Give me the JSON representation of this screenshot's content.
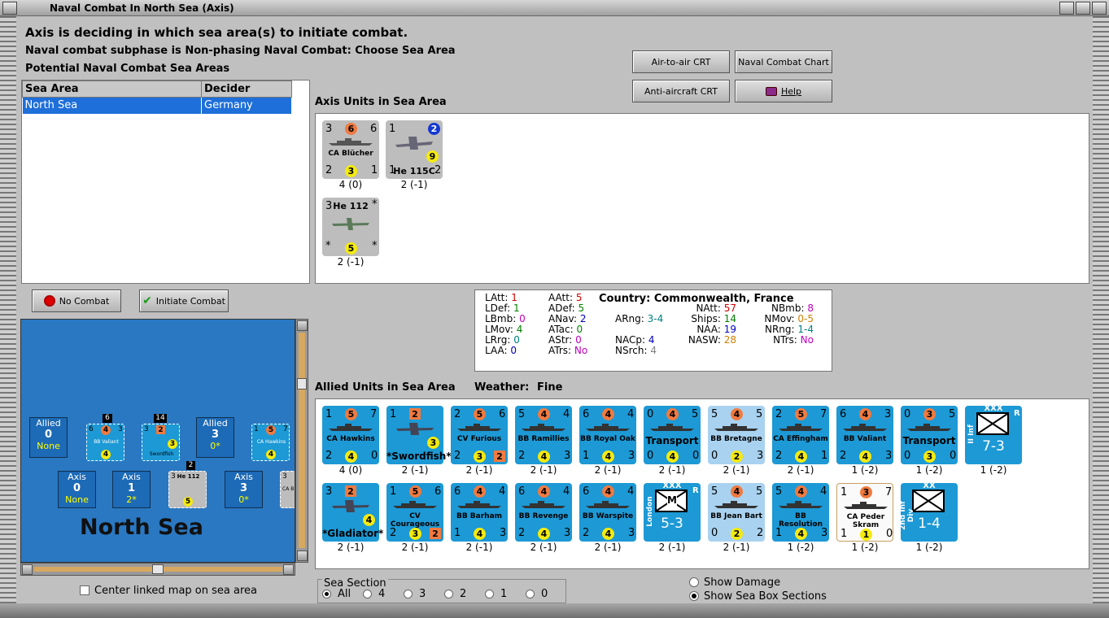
{
  "window": {
    "title": "Naval Combat In North Sea (Axis)"
  },
  "header": {
    "status": "Axis is deciding in which sea area(s) to initiate combat.",
    "subphase": "Naval combat subphase is Non-phasing Naval Combat: Choose Sea Area",
    "potential": "Potential Naval Combat Sea Areas"
  },
  "sea_table": {
    "col1": "Sea Area",
    "col2": "Decider",
    "rows": [
      {
        "area": "North Sea",
        "decider": "Germany"
      }
    ]
  },
  "buttons": {
    "air_crt": "Air-to-air CRT",
    "naval_chart": "Naval Combat Chart",
    "aa_crt": "Anti-aircraft CRT",
    "help": "Help",
    "no_combat": "No Combat",
    "initiate": "Initiate Combat"
  },
  "axis_section": {
    "title": "Axis Units in Sea Area"
  },
  "allied_section": {
    "title": "Allied Units in Sea Area",
    "weather_label": "Weather:",
    "weather": "Fine"
  },
  "axis_units": [
    {
      "a": "3",
      "b": "6",
      "c": "6",
      "name": "CA Blücher",
      "d": "2",
      "e": "3",
      "f": "1",
      "label": "4 (0)"
    },
    {
      "a": "1",
      "b": "2",
      "name": "He 115C",
      "n9": "9",
      "d": "1",
      "f": "2",
      "label": "2 (-1)"
    },
    {
      "a": "3",
      "name": "He 112",
      "star": "*",
      "e": "5",
      "label": "2 (-1)"
    }
  ],
  "stats": {
    "country_label": "Country:",
    "country": "Commonwealth, France",
    "col1": [
      [
        "LAtt:",
        "1"
      ],
      [
        "LDef:",
        "1"
      ],
      [
        "LBmb:",
        "0"
      ],
      [
        "LMov:",
        "4"
      ],
      [
        "LRrg:",
        "0"
      ],
      [
        "LAA:",
        "0"
      ]
    ],
    "col2": [
      [
        "AAtt:",
        "5"
      ],
      [
        "ADef:",
        "5"
      ],
      [
        "ANav:",
        "2"
      ],
      [
        "ATac:",
        "0"
      ],
      [
        "AStr:",
        "0"
      ],
      [
        "ATrs:",
        "No"
      ]
    ],
    "col3": [
      [
        "ARng:",
        "3-4"
      ],
      [
        "NACp:",
        "4"
      ],
      [
        "NSrch:",
        "4"
      ]
    ],
    "col4": [
      [
        "NAtt:",
        "57"
      ],
      [
        "Ships:",
        "14"
      ],
      [
        "NAA:",
        "19"
      ],
      [
        "NASW:",
        "28"
      ]
    ],
    "col5": [
      [
        "NBmb:",
        "8"
      ],
      [
        "NMov:",
        "0-5"
      ],
      [
        "NRng:",
        "1-4"
      ],
      [
        "NTrs:",
        "No"
      ]
    ],
    "colors": {
      "red": "#d00000",
      "green": "#008000",
      "purple": "#c000c0",
      "teal": "#008080",
      "orange": "#d08000",
      "blue": "#0000c0",
      "grey": "#808080"
    }
  },
  "allied_row1": [
    {
      "t": "ship",
      "a": "1",
      "b": "5",
      "c": "7",
      "name": "CA Hawkins",
      "d": "2",
      "e": "4",
      "f": "0",
      "label": "4 (0)"
    },
    {
      "t": "plane",
      "a": "1",
      "b": "2",
      "name": "*Swordfish*",
      "e": "3",
      "label": "2 (-1)"
    },
    {
      "t": "ship",
      "a": "2",
      "b": "5",
      "c": "6",
      "name": "CV Furious",
      "d": "2",
      "e": "3",
      "f": "2",
      "label": "2 (-1)"
    },
    {
      "t": "ship",
      "a": "5",
      "b": "4",
      "c": "4",
      "name": "BB Ramillies",
      "d": "2",
      "e": "4",
      "f": "3",
      "label": "2 (-1)"
    },
    {
      "t": "ship",
      "a": "6",
      "b": "4",
      "c": "4",
      "name": "BB Royal Oak",
      "d": "1",
      "e": "4",
      "f": "3",
      "label": "2 (-1)"
    },
    {
      "t": "ship",
      "a": "0",
      "b": "4",
      "c": "5",
      "name": "Transport",
      "d": "0",
      "e": "4",
      "f": "0",
      "label": "2 (-1)"
    },
    {
      "t": "ship",
      "a": "5",
      "b": "4",
      "c": "5",
      "name": "BB Bretagne",
      "d": "0",
      "e": "2",
      "f": "3",
      "label": "2 (-1)"
    },
    {
      "t": "ship",
      "a": "2",
      "b": "5",
      "c": "7",
      "name": "CA Effingham",
      "d": "2",
      "e": "4",
      "f": "1",
      "label": "2 (-1)"
    },
    {
      "t": "ship",
      "a": "6",
      "b": "4",
      "c": "3",
      "name": "BB Valiant",
      "d": "2",
      "e": "4",
      "f": "3",
      "label": "1 (-2)"
    },
    {
      "t": "ship",
      "a": "0",
      "b": "3",
      "c": "5",
      "name": "Transport",
      "d": "0",
      "e": "3",
      "f": "0",
      "label": "1 (-2)"
    },
    {
      "t": "army",
      "size": "XXX",
      "side": "II Inf",
      "r": "R",
      "val": "7-3",
      "label": "1 (-2)"
    }
  ],
  "allied_row2": [
    {
      "t": "plane",
      "a": "3",
      "b": "2",
      "name": "*Gladiator*",
      "e": "4",
      "label": "2 (-1)"
    },
    {
      "t": "ship",
      "a": "1",
      "b": "5",
      "c": "6",
      "name": "CV Courageous",
      "d": "2",
      "e": "3",
      "f": "2",
      "label": "2 (-1)"
    },
    {
      "t": "ship",
      "a": "6",
      "b": "4",
      "c": "4",
      "name": "BB Barham",
      "d": "1",
      "e": "4",
      "f": "3",
      "label": "2 (-1)"
    },
    {
      "t": "ship",
      "a": "6",
      "b": "4",
      "c": "4",
      "name": "BB Revenge",
      "d": "2",
      "e": "4",
      "f": "3",
      "label": "2 (-1)"
    },
    {
      "t": "ship",
      "a": "6",
      "b": "4",
      "c": "4",
      "name": "BB Warspite",
      "d": "2",
      "e": "4",
      "f": "3",
      "label": "2 (-1)"
    },
    {
      "t": "army",
      "size": "XXX",
      "side": "London",
      "r": "R",
      "m": "M",
      "val": "5-3",
      "label": "2 (-1)"
    },
    {
      "t": "ship",
      "a": "5",
      "b": "4",
      "c": "5",
      "name": "BB Jean Bart",
      "d": "0",
      "e": "2",
      "f": "2",
      "label": "2 (-1)"
    },
    {
      "t": "ship",
      "a": "5",
      "b": "4",
      "c": "4",
      "name": "BB Resolution",
      "d": "1",
      "e": "4",
      "f": "3",
      "label": "1 (-2)"
    },
    {
      "t": "ship",
      "a": "1",
      "b": "3",
      "c": "7",
      "name": "CA Peder Skram",
      "d": "1",
      "e": "1",
      "f": "0",
      "label": "1 (-2)"
    },
    {
      "t": "army",
      "size": "XX",
      "side": "2nd Inf Div",
      "val": "1-4",
      "label": "1 (-2)"
    }
  ],
  "map": {
    "name": "North Sea",
    "allied_label": "Allied",
    "axis_label": "Axis",
    "box1": {
      "num": "0",
      "sub": "None"
    },
    "box2": {
      "num": "3",
      "sub": "0*"
    },
    "axis1": {
      "num": "0",
      "sub": "None"
    },
    "axis2": {
      "num": "1",
      "sub": "2*"
    },
    "axis3": {
      "num": "3",
      "sub": "0*"
    },
    "stack1": "6",
    "stack2": "14",
    "stack3": "2",
    "m1": {
      "a": "6",
      "b": "4",
      "c": "3",
      "name": "BB Valiant",
      "e": "4"
    },
    "m2": {
      "a": "3",
      "b": "2",
      "name": "Swordfish",
      "e": "3"
    },
    "m3": {
      "a": "3",
      "name": "He 112",
      "e": "5"
    },
    "m4": {
      "a": "1",
      "b": "5",
      "c": "7",
      "name": "CA Hawkins",
      "e": "4"
    },
    "m5": {
      "a": "3",
      "name": "CA B"
    }
  },
  "center_map": "Center linked map on sea area",
  "sea_section": {
    "title": "Sea Section",
    "options": [
      "All",
      "4",
      "3",
      "2",
      "1",
      "0"
    ]
  },
  "show_damage": "Show Damage",
  "show_sea_box": "Show Sea Box Sections"
}
